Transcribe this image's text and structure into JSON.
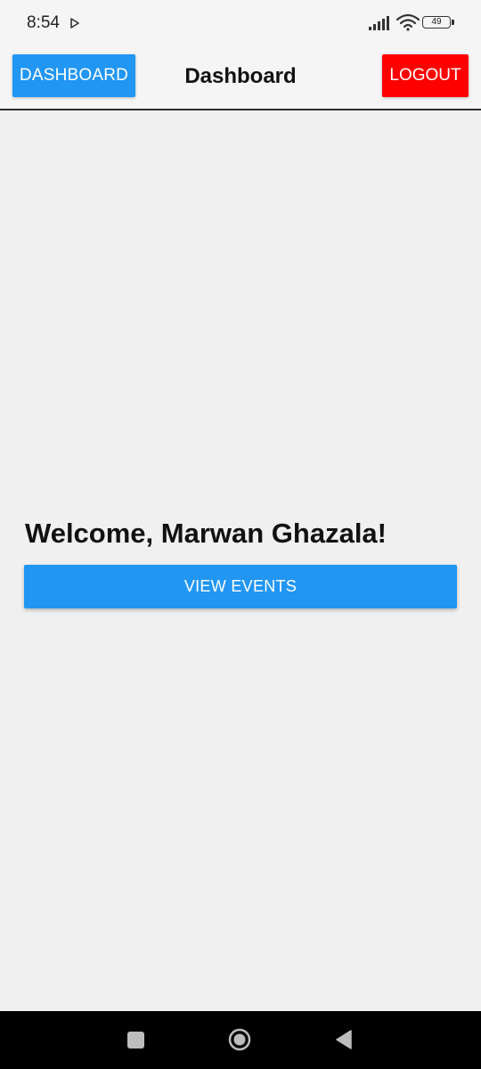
{
  "status_bar": {
    "time": "8:54",
    "battery": "49",
    "icons": [
      "play-icon",
      "signal-icon",
      "wifi-icon",
      "battery-icon"
    ]
  },
  "header": {
    "dashboard_button_label": "Dashboard",
    "title": "Dashboard",
    "logout_button_label": "Logout"
  },
  "main": {
    "welcome_text": "Welcome, Marwan Ghazala!",
    "view_events_label": "View Events"
  },
  "nav_bar": {
    "icons": [
      "recents-icon",
      "home-icon",
      "back-icon"
    ]
  },
  "colors": {
    "primary": "#2196f3",
    "danger": "#ff0000",
    "background": "#f0f0f0",
    "nav_bar": "#000000"
  }
}
